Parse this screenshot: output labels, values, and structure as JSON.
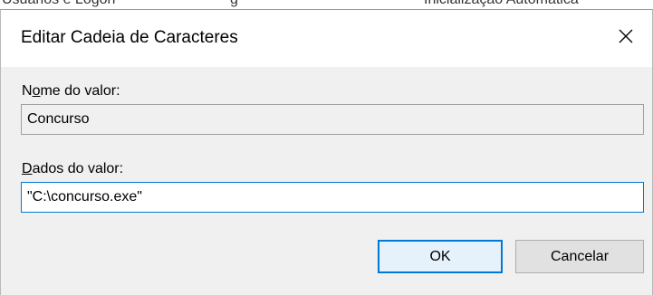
{
  "background": {
    "fragments": [
      "Usuários e Logon",
      "g",
      "Inicialização Automática"
    ]
  },
  "dialog": {
    "title": "Editar Cadeia de Caracteres",
    "close_icon": "close-icon",
    "value_name": {
      "label_pre": "N",
      "label_acc": "o",
      "label_post": "me do valor:",
      "value": "Concurso"
    },
    "value_data": {
      "label_pre": "",
      "label_acc": "D",
      "label_post": "ados do valor:",
      "value": "\"C:\\concurso.exe\""
    },
    "buttons": {
      "ok": "OK",
      "cancel": "Cancelar"
    }
  },
  "colors": {
    "accent": "#0078d7",
    "dialog_bg": "#f0f0f0",
    "button_bg": "#e1e1e1"
  }
}
